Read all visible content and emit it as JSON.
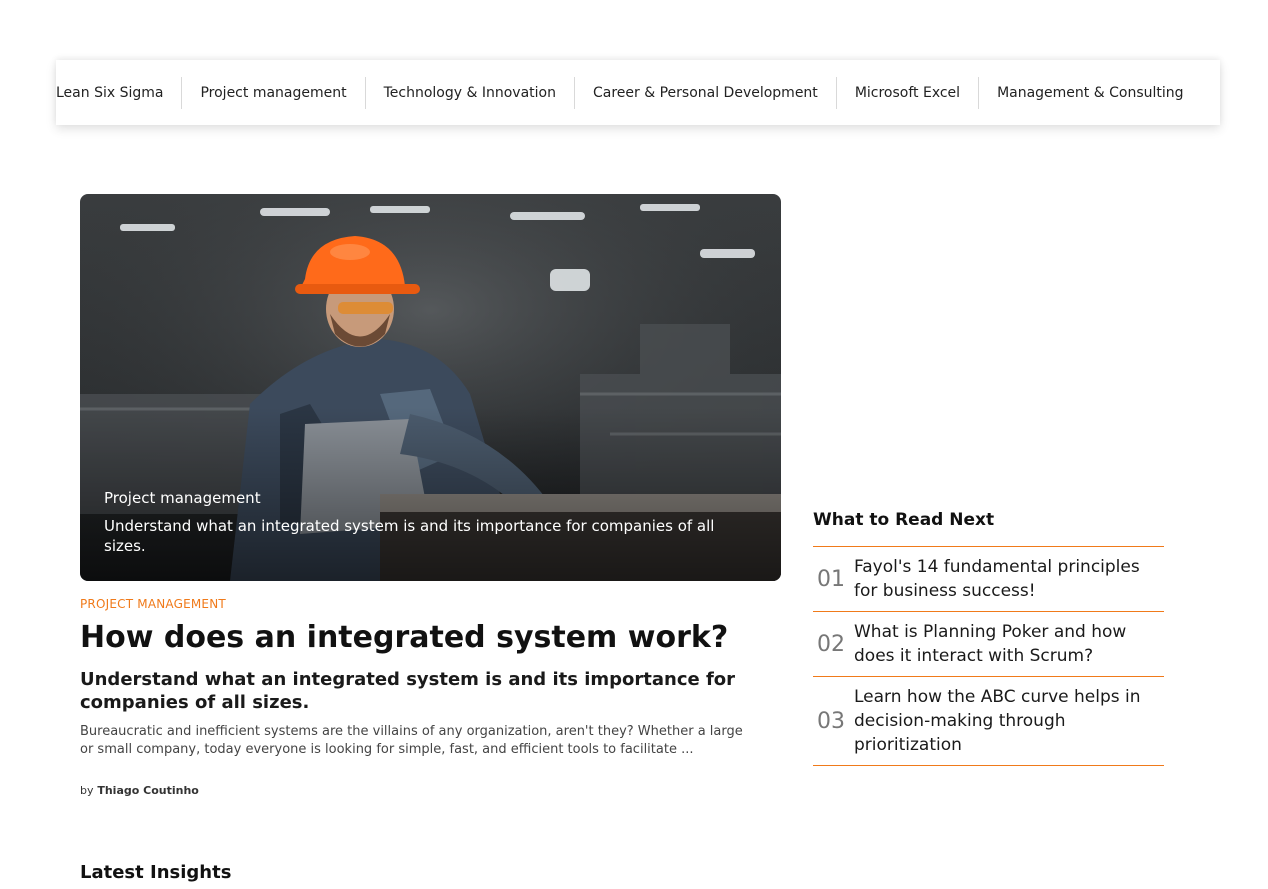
{
  "nav": {
    "items": [
      {
        "label": "Lean Six Sigma"
      },
      {
        "label": "Project management"
      },
      {
        "label": "Technology & Innovation"
      },
      {
        "label": "Career & Personal Development"
      },
      {
        "label": "Microsoft Excel"
      },
      {
        "label": "Management & Consulting"
      }
    ]
  },
  "hero": {
    "category": "Project management",
    "subtitle": "Understand what an integrated system is and its importance for companies of all sizes."
  },
  "article": {
    "kicker": "PROJECT MANAGEMENT",
    "title": "How does an integrated system work?",
    "subtitle": "Understand what an integrated system is and its importance for companies of all sizes.",
    "excerpt": "Bureaucratic and inefficient systems are the villains of any organization, aren't they? Whether a large or small company, today everyone is looking for simple, fast, and efficient tools to facilitate ...",
    "by": "by",
    "author": "Thiago Coutinho"
  },
  "sidebar": {
    "title": "What to Read Next",
    "items": [
      {
        "num": "01",
        "title": "Fayol's 14 fundamental principles for business success!"
      },
      {
        "num": "02",
        "title": "What is Planning Poker and how does it interact with Scrum?"
      },
      {
        "num": "03",
        "title": "Learn how the ABC curve helps in decision-making through prioritization"
      }
    ]
  },
  "latest": {
    "title": "Latest Insights"
  },
  "colors": {
    "accent": "#f07a1a",
    "helmet": "#ff6a1a"
  }
}
